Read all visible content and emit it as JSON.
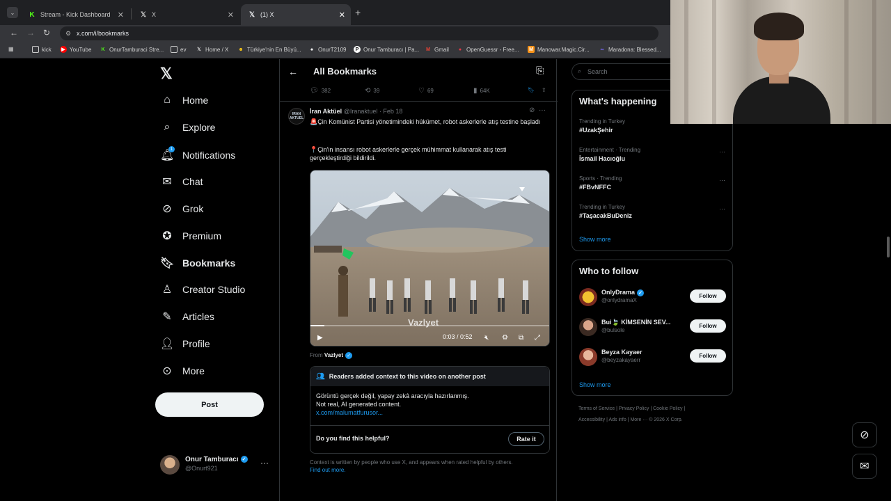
{
  "browser": {
    "tabs": [
      {
        "label": "Stream - Kick Dashboard",
        "icon": "kick-icon",
        "active": false
      },
      {
        "label": "X",
        "icon": "x-icon",
        "active": false
      },
      {
        "label": "(1) X",
        "icon": "x-icon",
        "active": true
      }
    ],
    "url": "x.com/i/bookmarks",
    "bookmarks": [
      {
        "label": "kick",
        "icon": "folder-icon"
      },
      {
        "label": "YouTube",
        "icon": "youtube-icon"
      },
      {
        "label": "OnurTamburaci Stre...",
        "icon": "kick-icon"
      },
      {
        "label": "ev",
        "icon": "folder-icon"
      },
      {
        "label": "Home / X",
        "icon": "x-icon"
      },
      {
        "label": "Türkiye'nin En Büyü...",
        "icon": "site-icon"
      },
      {
        "label": "OnurT2109",
        "icon": "site-icon"
      },
      {
        "label": "Onur Tamburacı | Pa...",
        "icon": "site-icon"
      },
      {
        "label": "Gmail",
        "icon": "gmail-icon"
      },
      {
        "label": "OpenGuessr - Free...",
        "icon": "site-icon"
      },
      {
        "label": "Manowar.Magic.Cir...",
        "icon": "site-icon"
      },
      {
        "label": "Maradona: Blessed...",
        "icon": "site-icon"
      }
    ]
  },
  "nav": {
    "items": [
      {
        "label": "Home",
        "icon": "home-icon"
      },
      {
        "label": "Explore",
        "icon": "search-icon"
      },
      {
        "label": "Notifications",
        "icon": "bell-icon",
        "badge": "1"
      },
      {
        "label": "Chat",
        "icon": "mail-icon"
      },
      {
        "label": "Grok",
        "icon": "grok-icon"
      },
      {
        "label": "Premium",
        "icon": "verified-icon"
      },
      {
        "label": "Bookmarks",
        "icon": "bookmark-icon",
        "active": true
      },
      {
        "label": "Creator Studio",
        "icon": "creator-icon"
      },
      {
        "label": "Articles",
        "icon": "articles-icon"
      },
      {
        "label": "Profile",
        "icon": "person-icon"
      },
      {
        "label": "More",
        "icon": "more-circle-icon"
      }
    ],
    "post_label": "Post",
    "account": {
      "name": "Onur Tamburacı",
      "handle": "@Onurt921"
    }
  },
  "header": {
    "title": "All Bookmarks"
  },
  "prev_actions": {
    "replies": "382",
    "reposts": "39",
    "likes": "69",
    "views": "64K"
  },
  "tweet": {
    "avatar_text": "IRAN AKTUEL",
    "author": "İran Aktüel",
    "handle": "@Iranaktuel",
    "date": "· Feb 18",
    "line1": "🚨Çin Komünist Partisi yönetimindeki hükümet, robot askerlerle atış testine başladı",
    "line2": "📍Çin'in insansı robot askerlerle gerçek mühimmat kullanarak atış testi gerçekleştirdiği bildirildi.",
    "video": {
      "time": "0:03 / 0:52",
      "watermark": "Vazlyet",
      "progress": 0.058
    },
    "from_prefix": "From",
    "from_name": "Vazlyet"
  },
  "community_note": {
    "title": "Readers added context to this video on another post",
    "text1": "Görüntü gerçek değil, yapay zekâ aracıyla hazırlanmış.",
    "text2": "Not real, AI generated content.",
    "link": "x.com/malumatfurusor...",
    "question": "Do you find this helpful?",
    "rate_label": "Rate it",
    "context": "Context is written by people who use X, and appears when rated helpful by others.",
    "find_out": "Find out more."
  },
  "right": {
    "search_placeholder": "Search",
    "happening_title": "What's happening",
    "trends": [
      {
        "category": "Trending in Turkey",
        "title": "#UzakŞehir"
      },
      {
        "category": "Entertainment · Trending",
        "title": "İsmail Hacıoğlu"
      },
      {
        "category": "Sports · Trending",
        "title": "#FBvNFFC"
      },
      {
        "category": "Trending in Turkey",
        "title": "#TaşacakBuDeniz"
      }
    ],
    "show_more": "Show more",
    "who_title": "Who to follow",
    "who": [
      {
        "name": "OnlyDrama",
        "handle": "@onlydramaX",
        "verified": "gold"
      },
      {
        "name": "Bui🍃 KİMSENİN SEV...",
        "handle": "@bulsole",
        "verified": ""
      },
      {
        "name": "Beyza Kayaer",
        "handle": "@beyzakayaerr",
        "verified": ""
      }
    ],
    "follow_label": "Follow",
    "footer1": "Terms of Service  |  Privacy Policy  |  Cookie Policy  |",
    "footer2": "Accessibility  |  Ads info  |  More ···  © 2026 X Corp."
  }
}
